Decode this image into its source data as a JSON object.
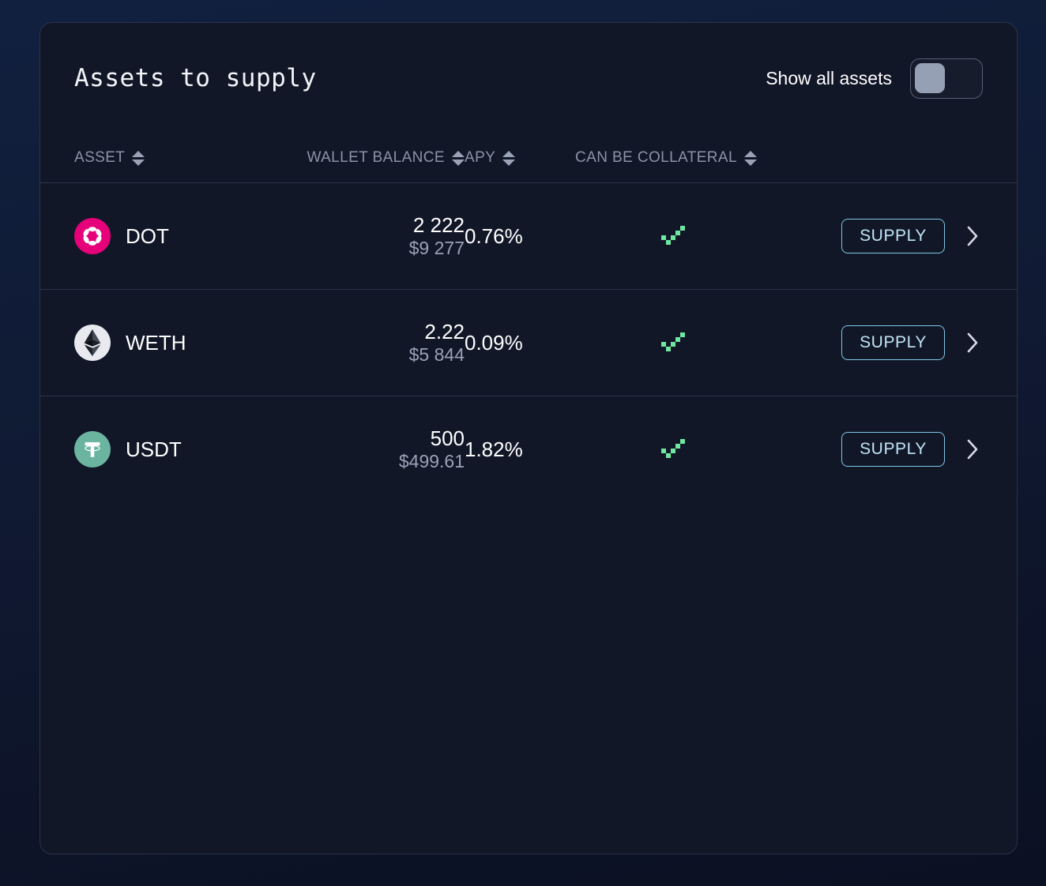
{
  "card": {
    "title": "Assets to supply",
    "show_all_label": "Show all assets",
    "show_all_enabled": false
  },
  "table": {
    "columns": [
      {
        "key": "asset",
        "label": "ASSET",
        "sortable": true
      },
      {
        "key": "wallet_balance",
        "label": "WALLET BALANCE",
        "sortable": true
      },
      {
        "key": "apy",
        "label": "APY",
        "sortable": true
      },
      {
        "key": "collateral",
        "label": "CAN BE COLLATERAL",
        "sortable": true
      }
    ],
    "rows": [
      {
        "symbol": "DOT",
        "icon": "polkadot-icon",
        "icon_color": "#e6007a",
        "balance": "2 222",
        "balance_usd": "$9 277",
        "apy": "0.76%",
        "can_be_collateral": true,
        "action_label": "SUPPLY"
      },
      {
        "symbol": "WETH",
        "icon": "ethereum-icon",
        "icon_color": "#e8eaf0",
        "balance": "2.22",
        "balance_usd": "$5 844",
        "apy": "0.09%",
        "can_be_collateral": true,
        "action_label": "SUPPLY"
      },
      {
        "symbol": "USDT",
        "icon": "tether-icon",
        "icon_color": "#6ab4a0",
        "balance": "500",
        "balance_usd": "$499.61",
        "apy": "1.82%",
        "can_be_collateral": true,
        "action_label": "SUPPLY"
      }
    ]
  },
  "theme": {
    "page_bg": "#101932",
    "card_bg": "#121728",
    "card_border": "#2b3348",
    "divider": "#2c3448",
    "text_primary": "#ffffff",
    "text_muted": "#9aa3b6",
    "header_muted": "#8b93a7",
    "accent_button": "#7ec8e3",
    "accent_button_text": "#bfe4f5",
    "check_green": "#6ee7a0",
    "toggle_knob": "#96a0b5"
  }
}
